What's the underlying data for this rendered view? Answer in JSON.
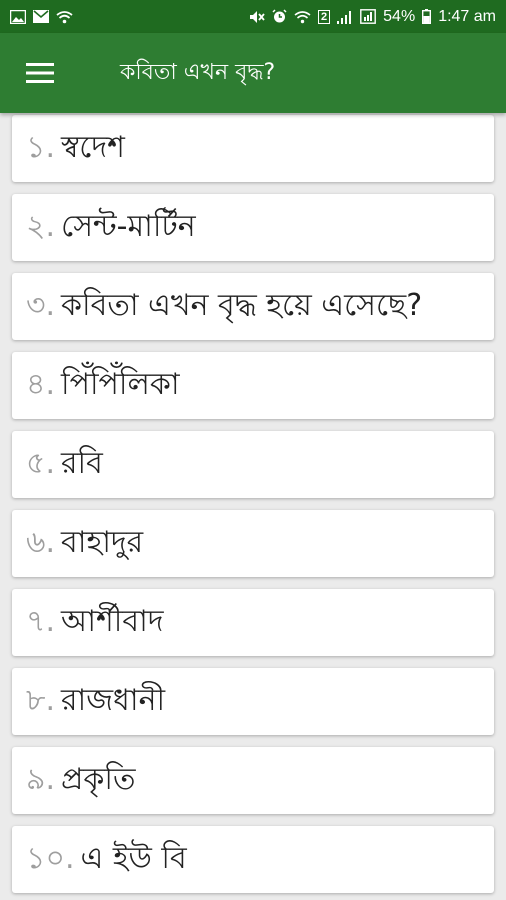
{
  "status": {
    "battery": "54%",
    "time": "1:47 am",
    "sim_badge": "2"
  },
  "app_bar": {
    "title": "কবিতা এখন বৃদ্ধ?"
  },
  "items": [
    {
      "num": "১.",
      "title": "স্বদেশ"
    },
    {
      "num": "২.",
      "title": "সেন্ট-মার্টিন"
    },
    {
      "num": "৩.",
      "title": "কবিতা এখন বৃদ্ধ হয়ে এসেছে?"
    },
    {
      "num": "৪.",
      "title": "পিঁপিঁলিকা"
    },
    {
      "num": "৫.",
      "title": "রবি"
    },
    {
      "num": "৬.",
      "title": "বাহাদুর"
    },
    {
      "num": "৭.",
      "title": "আর্শীবাদ"
    },
    {
      "num": "৮.",
      "title": "রাজধানী"
    },
    {
      "num": "৯.",
      "title": "প্রকৃতি"
    },
    {
      "num": "১০.",
      "title": "এ ইউ বি"
    }
  ],
  "colors": {
    "status_bar": "#1f6b20",
    "app_bar": "#2e7d32",
    "background": "#ebebeb"
  }
}
